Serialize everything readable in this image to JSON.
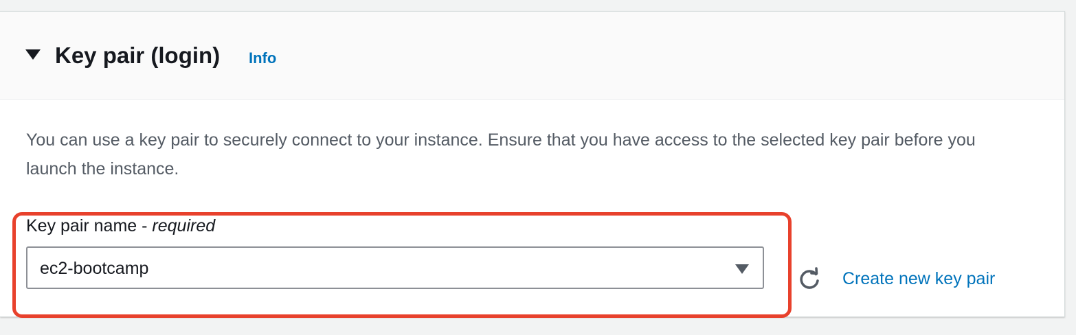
{
  "section": {
    "title": "Key pair (login)",
    "info_label": "Info",
    "description": "You can use a key pair to securely connect to your instance. Ensure that you have access to the selected key pair before you launch the instance.",
    "expanded_icon": "caret-down-icon"
  },
  "key_pair_field": {
    "label": "Key pair name",
    "label_separator": " - ",
    "required_label": "required",
    "selected_value": "ec2-bootcamp",
    "dropdown_icon": "caret-down-icon"
  },
  "actions": {
    "refresh_icon": "refresh-icon",
    "create_label": "Create new key pair"
  },
  "colors": {
    "link": "#0073bb",
    "highlight": "#e8412c",
    "text_primary": "#16191f",
    "text_secondary": "#545b64"
  }
}
